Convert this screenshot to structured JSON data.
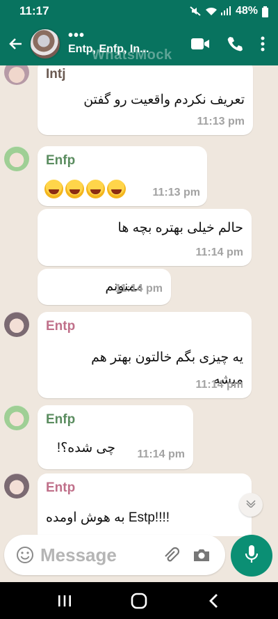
{
  "status_bar": {
    "time": "11:17",
    "battery": "48%"
  },
  "header": {
    "dots": "•••",
    "title": "Entp, Enfp, In...",
    "watermark": "WhatsMock"
  },
  "messages": [
    {
      "sender": "Intj",
      "sender_color": "#6b5a52",
      "text": "تعریف نکردم واقعیت رو گفتن",
      "time": "11:13 pm"
    },
    {
      "sender": "Enfp",
      "sender_color": "#5a8c5f",
      "emoji_count": 4,
      "time": "11:13 pm"
    },
    {
      "sender": "",
      "text": "حالم خیلی بهتره بچه ها",
      "time": "11:14 pm"
    },
    {
      "sender": "",
      "text": "ممنونم",
      "time": "11:14 pm"
    },
    {
      "sender": "Entp",
      "sender_color": "#c0708a",
      "text": "یه چیزی بگم خالتون بهتر هم",
      "text2": "میشه",
      "time": "11:14 pm"
    },
    {
      "sender": "Enfp",
      "sender_color": "#5a8c5f",
      "text": "چی شده؟!",
      "time": "11:14 pm"
    },
    {
      "sender": "Entp",
      "sender_color": "#c0708a",
      "text": "به هوش اومده Estp!!!!"
    }
  ],
  "composer": {
    "placeholder": "Message"
  },
  "colors": {
    "header": "#08735f",
    "chat_bg": "#efe7de",
    "mic": "#0b8f74"
  },
  "icons": [
    "back-arrow-icon",
    "video-call-icon",
    "phone-icon",
    "more-vert-icon",
    "emoji-icon",
    "attach-icon",
    "camera-icon",
    "mic-icon",
    "chevron-down-icon",
    "recents-icon",
    "home-icon",
    "back-nav-icon"
  ]
}
